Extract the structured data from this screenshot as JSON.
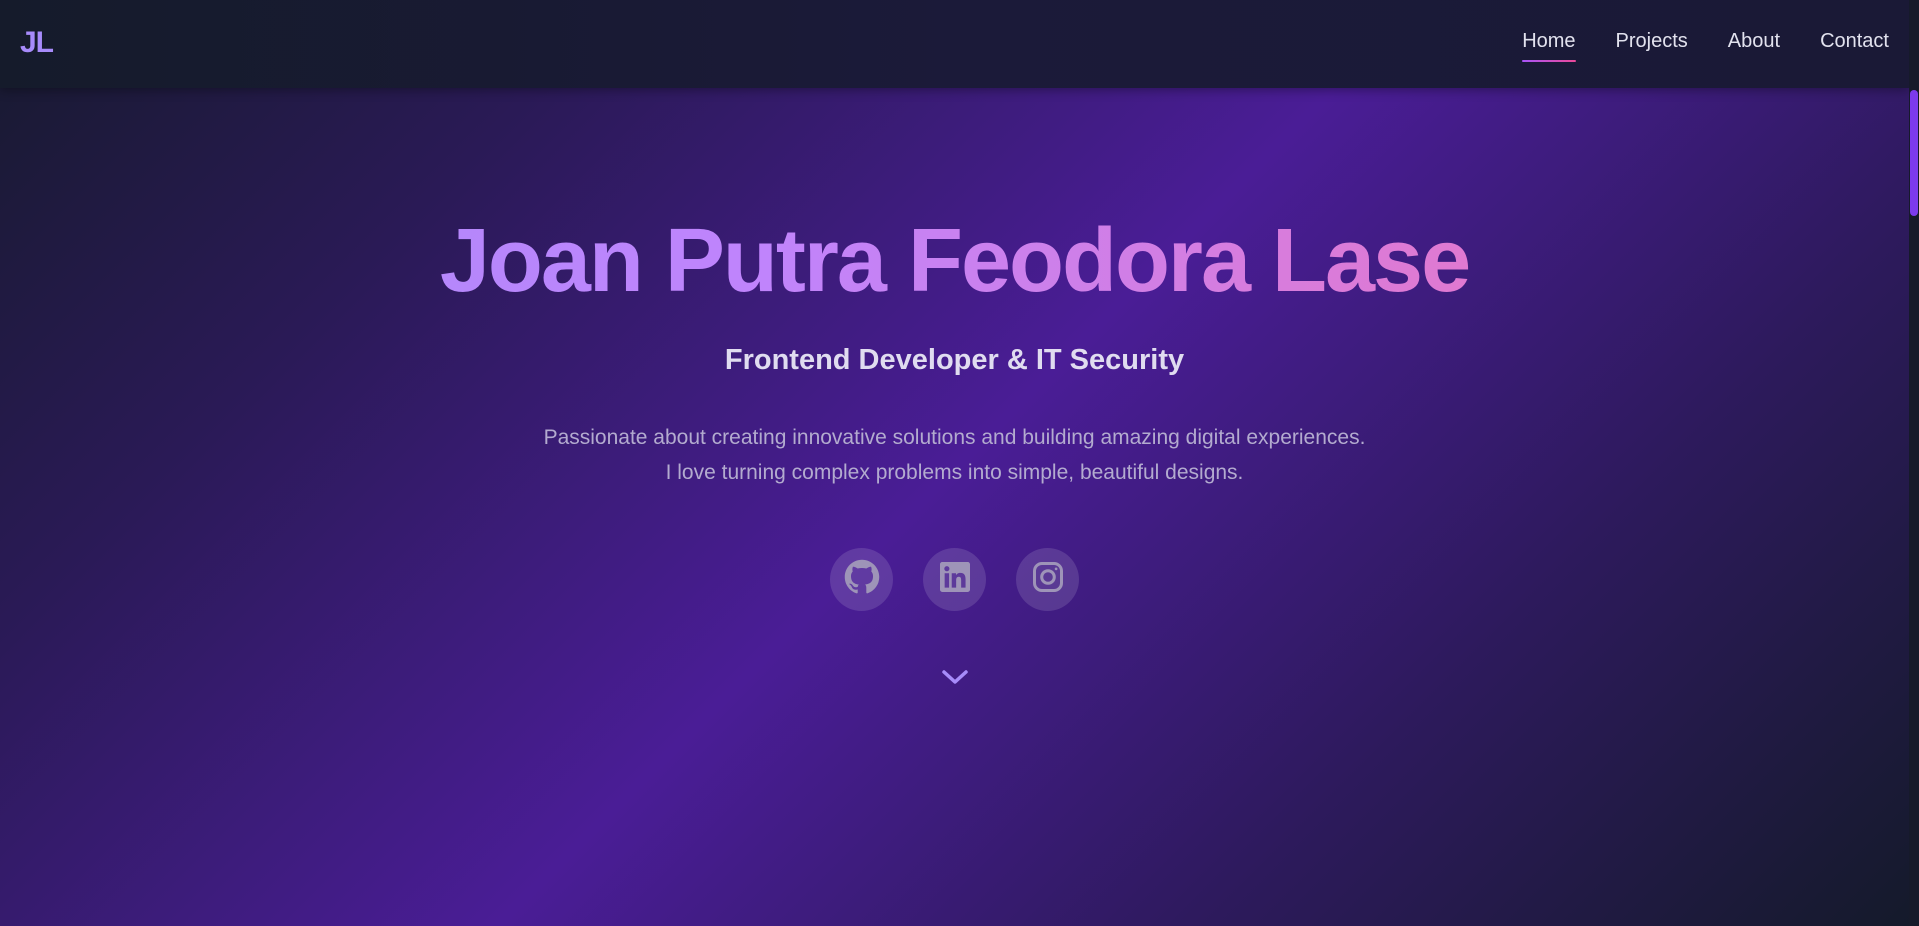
{
  "header": {
    "logo": "JL",
    "nav": [
      {
        "label": "Home",
        "active": true
      },
      {
        "label": "Projects",
        "active": false
      },
      {
        "label": "About",
        "active": false
      },
      {
        "label": "Contact",
        "active": false
      }
    ]
  },
  "hero": {
    "name": "Joan Putra Feodora Lase",
    "role": "Frontend Developer & IT Security",
    "description": "Passionate about creating innovative solutions and building amazing digital experiences. I love turning complex problems into simple, beautiful designs.",
    "socials": [
      {
        "icon": "github-icon"
      },
      {
        "icon": "linkedin-icon"
      },
      {
        "icon": "instagram-icon"
      }
    ],
    "scroll_icon": "chevron-down-icon"
  },
  "colors": {
    "accent": "#a78bfa",
    "accent_pink": "#f472b6",
    "icon": "#9e94b8"
  }
}
